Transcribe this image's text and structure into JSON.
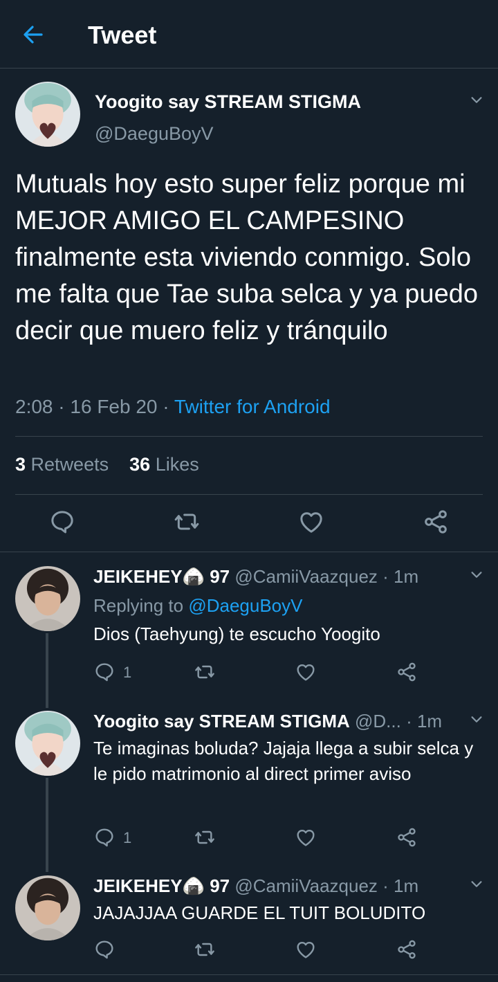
{
  "header": {
    "title": "Tweet",
    "back_icon": "arrow-left-icon"
  },
  "main_tweet": {
    "name": "Yoogito say STREAM STIGMA",
    "handle": "@DaeguBoyV",
    "text": "Mutuals hoy esto super feliz porque mi MEJOR AMIGO EL CAMPESINO finalmente esta viviendo conmigo. Solo me falta que Tae suba selca y ya puedo decir que muero feliz y tránquilo",
    "time": "2:08",
    "date": "16 Feb 20",
    "source": "Twitter for Android",
    "retweets": "3",
    "retweets_label": "Retweets",
    "likes": "36",
    "likes_label": "Likes"
  },
  "replies": [
    {
      "name": "JEIKEHEY🍙 97",
      "handle": "@CamiiVaazquez · 1m",
      "replying_label": "Replying to",
      "replying_to": "@DaeguBoyV",
      "text": "Dios (Taehyung) te escucho Yoogito",
      "reply_count": "1"
    },
    {
      "name": "Yoogito say STREAM STIGMA",
      "handle": "@D... · 1m",
      "text": "Te imaginas boluda? Jajaja llega a subir selca y le pido matrimonio al direct primer aviso",
      "reply_count": "1"
    },
    {
      "name": "JEIKEHEY🍙 97",
      "handle": "@CamiiVaazquez · 1m",
      "text": "JAJAJJAA GUARDE EL TUIT BOLUDITO"
    }
  ],
  "colors": {
    "background": "#15202b",
    "accent": "#1da1f2",
    "muted": "#8899a6",
    "border": "#38444d"
  }
}
